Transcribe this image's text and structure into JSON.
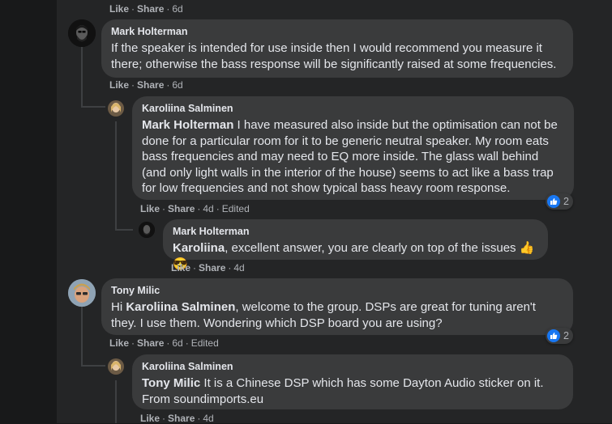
{
  "top_actions": {
    "like": "Like",
    "share": "Share",
    "age": "6d"
  },
  "comments": [
    {
      "author": "Mark Holterman",
      "text": "If the speaker is intended for use inside then I would recommend you measure it there; otherwise the bass response will be significantly raised at some frequencies.",
      "like": "Like",
      "share": "Share",
      "age": "6d"
    },
    {
      "author": "Karoliina Salminen",
      "mention": "Mark Holterman",
      "text": " I have measured also inside but the optimisation can not be done for a particular room for it to be generic neutral speaker. My room eats bass frequencies and may need to EQ more inside. The glass wall behind (and only light walls in the interior of the house) seems to act like a bass trap for low frequencies and not show typical bass heavy room response.",
      "like": "Like",
      "share": "Share",
      "age": "4d",
      "edited": "Edited",
      "reaction_count": "2"
    },
    {
      "author": "Mark Holterman",
      "mention": "Karoliina",
      "text": ", excellent answer, you are clearly on top of the issues",
      "emoji1": "👍",
      "emoji2": "😎",
      "like": "Like",
      "share": "Share",
      "age": "4d"
    },
    {
      "author": "Tony Milic",
      "pre": "Hi ",
      "mention": "Karoliina Salminen",
      "text": ", welcome to the group. DSPs are great for tuning aren't they. I use them. Wondering which DSP board you are using?",
      "like": "Like",
      "share": "Share",
      "age": "6d",
      "edited": "Edited",
      "reaction_count": "2"
    },
    {
      "author": "Karoliina Salminen",
      "mention": "Tony Milic",
      "text": " It is a Chinese DSP which has some Dayton Audio sticker on it. From soundimports.eu",
      "like": "Like",
      "share": "Share",
      "age": "4d"
    }
  ],
  "colors": {
    "background": "#242526",
    "bubble": "#3a3b3c",
    "accent": "#1877f2",
    "muted": "#b0b3b8"
  }
}
